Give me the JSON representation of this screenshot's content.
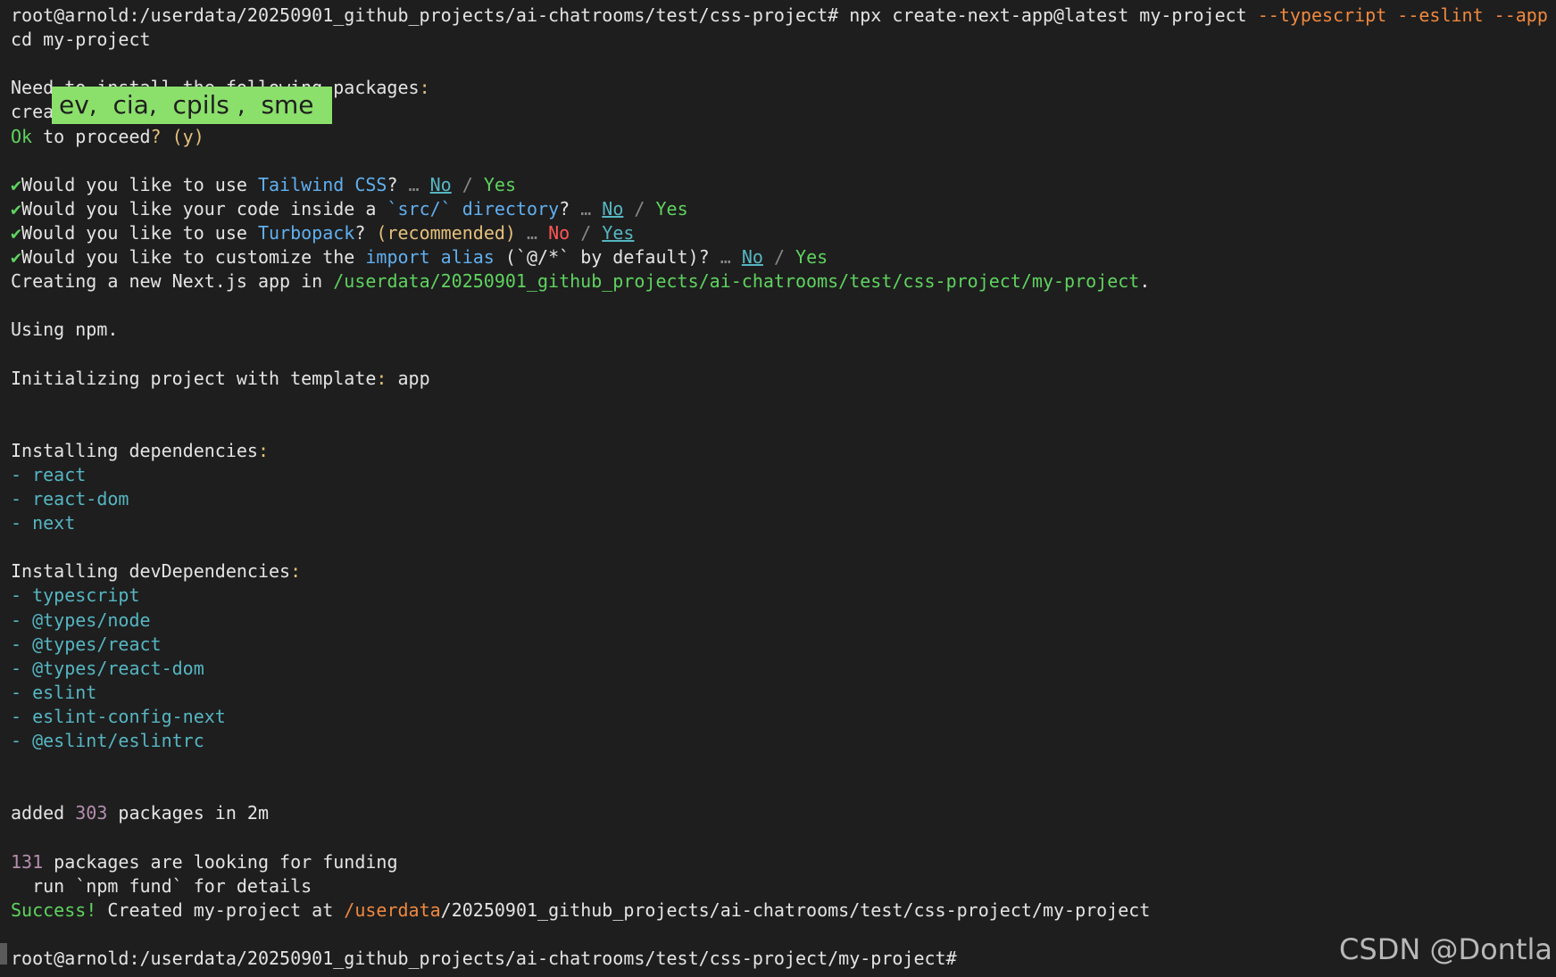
{
  "terminal": {
    "lines": [
      [
        {
          "t": "root@arnold:/userdata/20250901_github_projects/ai-chatrooms/test/css-project# npx create-next-app@latest my-project ",
          "c": "plain"
        },
        {
          "t": "--typescript --eslint --app",
          "c": "orange"
        }
      ],
      [
        {
          "t": "cd my-project",
          "c": "plain"
        }
      ],
      [],
      [
        {
          "t": "Need to install the following packages",
          "c": "plain"
        },
        {
          "t": ":",
          "c": "yellow"
        }
      ],
      [
        {
          "t": "crea",
          "c": "plain"
        }
      ],
      [
        {
          "t": "Ok",
          "c": "green"
        },
        {
          "t": " to proceed",
          "c": "plain"
        },
        {
          "t": "?",
          "c": "yellow"
        },
        {
          "t": " (y)",
          "c": "yellow"
        }
      ],
      [],
      [
        {
          "t": "✔",
          "c": "green"
        },
        {
          "t": "Would you like to use ",
          "c": "plain"
        },
        {
          "t": "Tailwind CSS",
          "c": "blue"
        },
        {
          "t": "? ",
          "c": "plain"
        },
        {
          "t": "…",
          "c": "gray"
        },
        {
          "t": " ",
          "c": "plain"
        },
        {
          "t": "No",
          "c": "cyan ul"
        },
        {
          "t": " / ",
          "c": "gray"
        },
        {
          "t": "Yes",
          "c": "green"
        }
      ],
      [
        {
          "t": "✔",
          "c": "green"
        },
        {
          "t": "Would you like your code inside a ",
          "c": "plain"
        },
        {
          "t": "`src/` directory",
          "c": "blue"
        },
        {
          "t": "? ",
          "c": "plain"
        },
        {
          "t": "…",
          "c": "gray"
        },
        {
          "t": " ",
          "c": "plain"
        },
        {
          "t": "No",
          "c": "cyan ul"
        },
        {
          "t": " / ",
          "c": "gray"
        },
        {
          "t": "Yes",
          "c": "green"
        }
      ],
      [
        {
          "t": "✔",
          "c": "green"
        },
        {
          "t": "Would you like to use ",
          "c": "plain"
        },
        {
          "t": "Turbopack",
          "c": "blue"
        },
        {
          "t": "? ",
          "c": "plain"
        },
        {
          "t": "(recommended)",
          "c": "yellow"
        },
        {
          "t": " ",
          "c": "plain"
        },
        {
          "t": "…",
          "c": "gray"
        },
        {
          "t": " ",
          "c": "plain"
        },
        {
          "t": "No",
          "c": "red"
        },
        {
          "t": " / ",
          "c": "gray"
        },
        {
          "t": "Yes",
          "c": "cyan ul"
        }
      ],
      [
        {
          "t": "✔",
          "c": "green"
        },
        {
          "t": "Would you like to customize the ",
          "c": "plain"
        },
        {
          "t": "import alias",
          "c": "blue"
        },
        {
          "t": " (`@/*` by default)? ",
          "c": "plain"
        },
        {
          "t": "…",
          "c": "gray"
        },
        {
          "t": " ",
          "c": "plain"
        },
        {
          "t": "No",
          "c": "cyan ul"
        },
        {
          "t": " / ",
          "c": "gray"
        },
        {
          "t": "Yes",
          "c": "green"
        }
      ],
      [
        {
          "t": "Creating a new Next.js app in ",
          "c": "plain"
        },
        {
          "t": "/userdata/20250901_github_projects/ai-chatrooms/test/css-project/my-project",
          "c": "green"
        },
        {
          "t": ".",
          "c": "plain"
        }
      ],
      [],
      [
        {
          "t": "Using npm.",
          "c": "plain"
        }
      ],
      [],
      [
        {
          "t": "Initializing project with template",
          "c": "plain"
        },
        {
          "t": ":",
          "c": "yellow"
        },
        {
          "t": " app",
          "c": "plain"
        }
      ],
      [],
      [],
      [
        {
          "t": "Installing dependencies",
          "c": "plain"
        },
        {
          "t": ":",
          "c": "yellow"
        }
      ],
      [
        {
          "t": "- ",
          "c": "cyan"
        },
        {
          "t": "react",
          "c": "cyan"
        }
      ],
      [
        {
          "t": "- ",
          "c": "cyan"
        },
        {
          "t": "react-dom",
          "c": "cyan"
        }
      ],
      [
        {
          "t": "- ",
          "c": "cyan"
        },
        {
          "t": "next",
          "c": "cyan"
        }
      ],
      [],
      [
        {
          "t": "Installing devDependencies",
          "c": "plain"
        },
        {
          "t": ":",
          "c": "yellow"
        }
      ],
      [
        {
          "t": "- ",
          "c": "cyan"
        },
        {
          "t": "typescript",
          "c": "cyan"
        }
      ],
      [
        {
          "t": "- ",
          "c": "cyan"
        },
        {
          "t": "@types/node",
          "c": "cyan"
        }
      ],
      [
        {
          "t": "- ",
          "c": "cyan"
        },
        {
          "t": "@types/react",
          "c": "cyan"
        }
      ],
      [
        {
          "t": "- ",
          "c": "cyan"
        },
        {
          "t": "@types/react-dom",
          "c": "cyan"
        }
      ],
      [
        {
          "t": "- ",
          "c": "cyan"
        },
        {
          "t": "eslint",
          "c": "cyan"
        }
      ],
      [
        {
          "t": "- ",
          "c": "cyan"
        },
        {
          "t": "eslint-config-next",
          "c": "cyan"
        }
      ],
      [
        {
          "t": "- ",
          "c": "cyan"
        },
        {
          "t": "@eslint/eslintrc",
          "c": "cyan"
        }
      ],
      [],
      [],
      [
        {
          "t": "added ",
          "c": "plain"
        },
        {
          "t": "303",
          "c": "purple"
        },
        {
          "t": " packages in 2m",
          "c": "plain"
        }
      ],
      [],
      [
        {
          "t": "131",
          "c": "purple"
        },
        {
          "t": " packages are looking for funding",
          "c": "plain"
        }
      ],
      [
        {
          "t": "  run `npm fund` for details",
          "c": "plain"
        }
      ],
      [
        {
          "t": "Success!",
          "c": "green"
        },
        {
          "t": " Created my-project at ",
          "c": "plain"
        },
        {
          "t": "/userdata",
          "c": "orange"
        },
        {
          "t": "/20250901_github_projects/ai-chatrooms/test/css-project/my-project",
          "c": "plain"
        }
      ],
      [],
      [
        {
          "t": "root@arnold:/userdata/20250901_github_projects/ai-chatrooms/test/css-project/my-project#",
          "c": "plain"
        }
      ]
    ]
  },
  "ime_overlay": {
    "text": "ev,  cia,  cpils ,  sme"
  },
  "watermark": {
    "text": "CSDN @Dontla"
  },
  "colors": {
    "background": "#1e1e1e",
    "foreground": "#e4e4e4",
    "orange": "#f0883e",
    "green": "#5fd35f",
    "yellow": "#e5c07b",
    "blue": "#61afef",
    "cyan": "#56b6c2",
    "purple": "#b48ead",
    "red": "#ff5555",
    "ime_highlight": "#8be06b"
  }
}
